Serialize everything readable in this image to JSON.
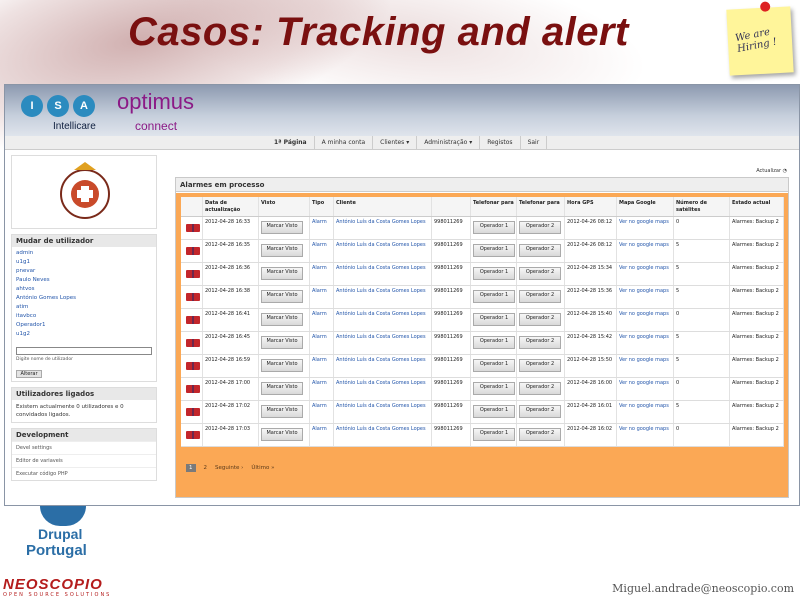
{
  "slide": {
    "title": "Casos: Tracking and alert",
    "sticky_note": "We are Hiring !",
    "email": "Miguel.andrade@neoscopio.com",
    "drupal_line1": "Drupal",
    "drupal_line2": "Portugal",
    "company": "NEOSCOPIO",
    "company_tagline": "OPEN SOURCE SOLUTIONS"
  },
  "header": {
    "isa_letters": [
      "I",
      "S",
      "A"
    ],
    "intellicare": "Intellicare",
    "brand": "optimus",
    "brand_sub": "connect"
  },
  "nav": {
    "items": [
      "1ª Página",
      "A minha conta",
      "Clientes ▾",
      "Administração ▾",
      "Registos",
      "Sair"
    ]
  },
  "sidebar": {
    "switch_title": "Mudar de utilizador",
    "users": [
      "admin",
      "u1g1",
      "pnevar",
      "Paulo Neves",
      "ahtvos",
      "António Gomes Lopes",
      "atim",
      "itavbco",
      "Operador1",
      "u1g2"
    ],
    "switch_help": "Digite nome de utilizador",
    "switch_button": "Alterar",
    "online_title": "Utilizadores ligados",
    "online_text": "Existem actualmente 0 utilizadores e 0 convidados ligados.",
    "dev_title": "Development",
    "dev_items": [
      "Devel settings",
      "Editor de variaveis",
      "Executar código PHP"
    ]
  },
  "main": {
    "refresh": "Actualizar",
    "panel_title": "Alarmes em processo",
    "columns": [
      "",
      "Data de actualização",
      "Visto",
      "Tipo",
      "Cliente",
      "",
      "Telefonar para",
      "Telefonar para",
      "Hora GPS",
      "Mapa Google",
      "Número de satélites",
      "Estado actual"
    ],
    "mark_label": "Marcar Visto",
    "rows": [
      {
        "date": "2012-04-28 16:33",
        "tipo": "Alarm",
        "cliente": "António Luís da Costa Gomes Lopes",
        "phone": "998011269",
        "op1": "Operador 1",
        "op2": "Operador 2",
        "gps": "2012-04-26 08:12",
        "map": "Ver no google maps",
        "sat": "0",
        "estado": "Alarmes: Backup 2"
      },
      {
        "date": "2012-04-28 16:35",
        "tipo": "Alarm",
        "cliente": "António Luís da Costa Gomes Lopes",
        "phone": "998011269",
        "op1": "Operador 1",
        "op2": "Operador 2",
        "gps": "2012-04-26 08:12",
        "map": "Ver no google maps",
        "sat": "5",
        "estado": "Alarmes: Backup 2"
      },
      {
        "date": "2012-04-28 16:36",
        "tipo": "Alarm",
        "cliente": "António Luís da Costa Gomes Lopes",
        "phone": "998011269",
        "op1": "Operador 1",
        "op2": "Operador 2",
        "gps": "2012-04-28 15:34",
        "map": "Ver no google maps",
        "sat": "5",
        "estado": "Alarmes: Backup 2"
      },
      {
        "date": "2012-04-28 16:38",
        "tipo": "Alarm",
        "cliente": "António Luís da Costa Gomes Lopes",
        "phone": "998011269",
        "op1": "Operador 1",
        "op2": "Operador 2",
        "gps": "2012-04-28 15:36",
        "map": "Ver no google maps",
        "sat": "5",
        "estado": "Alarmes: Backup 2"
      },
      {
        "date": "2012-04-28 16:41",
        "tipo": "Alarm",
        "cliente": "António Luís da Costa Gomes Lopes",
        "phone": "998011269",
        "op1": "Operador 1",
        "op2": "Operador 2",
        "gps": "2012-04-28 15:40",
        "map": "Ver no google maps",
        "sat": "0",
        "estado": "Alarmes: Backup 2"
      },
      {
        "date": "2012-04-28 16:45",
        "tipo": "Alarm",
        "cliente": "António Luís da Costa Gomes Lopes",
        "phone": "998011269",
        "op1": "Operador 1",
        "op2": "Operador 2",
        "gps": "2012-04-28 15:42",
        "map": "Ver no google maps",
        "sat": "5",
        "estado": "Alarmes: Backup 2"
      },
      {
        "date": "2012-04-28 16:59",
        "tipo": "Alarm",
        "cliente": "António Luís da Costa Gomes Lopes",
        "phone": "998011269",
        "op1": "Operador 1",
        "op2": "Operador 2",
        "gps": "2012-04-28 15:50",
        "map": "Ver no google maps",
        "sat": "5",
        "estado": "Alarmes: Backup 2"
      },
      {
        "date": "2012-04-28 17:00",
        "tipo": "Alarm",
        "cliente": "António Luís da Costa Gomes Lopes",
        "phone": "998011269",
        "op1": "Operador 1",
        "op2": "Operador 2",
        "gps": "2012-04-28 16:00",
        "map": "Ver no google maps",
        "sat": "0",
        "estado": "Alarmes: Backup 2"
      },
      {
        "date": "2012-04-28 17:02",
        "tipo": "Alarm",
        "cliente": "António Luís da Costa Gomes Lopes",
        "phone": "998011269",
        "op1": "Operador 1",
        "op2": "Operador 2",
        "gps": "2012-04-28 16:01",
        "map": "Ver no google maps",
        "sat": "5",
        "estado": "Alarmes: Backup 2"
      },
      {
        "date": "2012-04-28 17:03",
        "tipo": "Alarm",
        "cliente": "António Luís da Costa Gomes Lopes",
        "phone": "998011269",
        "op1": "Operador 1",
        "op2": "Operador 2",
        "gps": "2012-04-28 16:02",
        "map": "Ver no google maps",
        "sat": "0",
        "estado": "Alarmes: Backup 2"
      }
    ],
    "pager": {
      "current": "1",
      "next_page": "2",
      "next": "Seguinte ›",
      "last": "Último »"
    }
  },
  "colors": {
    "title": "#7a1010",
    "brand": "#8b1a86",
    "orange": "#fba855",
    "link": "#2255aa"
  }
}
